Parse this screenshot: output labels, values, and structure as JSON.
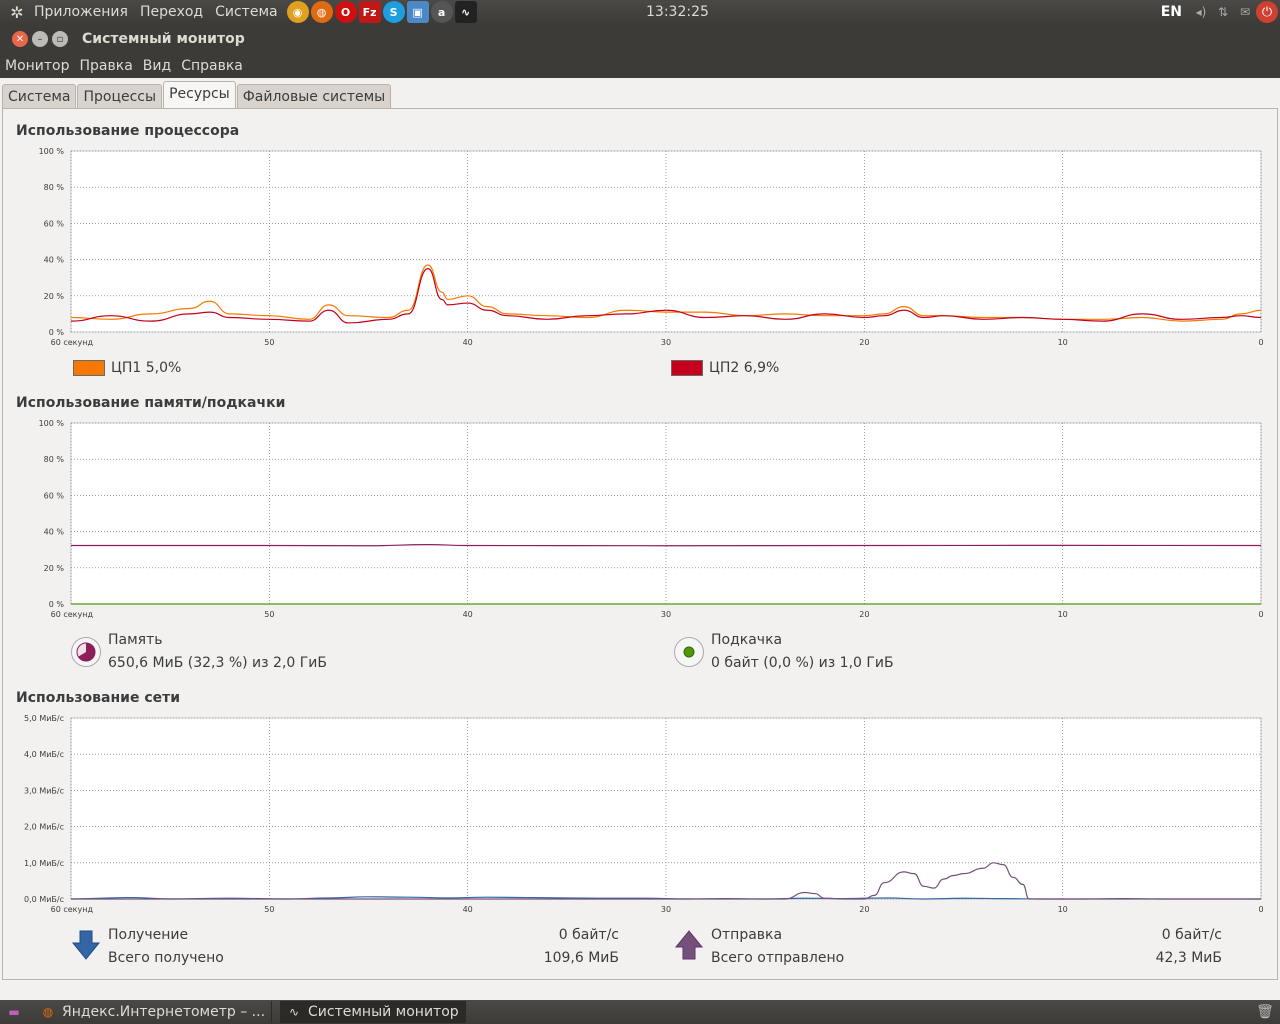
{
  "top_panel": {
    "menus": [
      "Приложения",
      "Переход",
      "Система"
    ],
    "launchers": [
      {
        "icon": "chrome-icon",
        "color": "#e0a020",
        "glyph": "◉"
      },
      {
        "icon": "firefox-icon",
        "color": "#e06a10",
        "glyph": "◍"
      },
      {
        "icon": "opera-icon",
        "color": "#d01010",
        "glyph": "O"
      },
      {
        "icon": "filezilla-icon",
        "color": "#c01818",
        "glyph": "Fz"
      },
      {
        "icon": "skype-icon",
        "color": "#1e9ee0",
        "glyph": "S"
      },
      {
        "icon": "virtualbox-icon",
        "color": "#4a88c8",
        "glyph": "▣"
      },
      {
        "icon": "at-icon",
        "color": "#555555",
        "glyph": "a"
      },
      {
        "icon": "system-monitor-icon",
        "color": "#222222",
        "glyph": "∿"
      }
    ],
    "clock": "13:32:25",
    "keyboard_layout": "EN"
  },
  "window": {
    "title": "Системный монитор",
    "menus": [
      "Монитор",
      "Правка",
      "Вид",
      "Справка"
    ],
    "tabs": [
      "Система",
      "Процессы",
      "Ресурсы",
      "Файловые системы"
    ],
    "active_tab": "Ресурсы"
  },
  "cpu": {
    "title": "Использование процессора",
    "legend": [
      {
        "label": "ЦП1 5,0%",
        "color": "#f57900"
      },
      {
        "label": "ЦП2 6,9%",
        "color": "#c4001c"
      }
    ]
  },
  "memory": {
    "title": "Использование памяти/подкачки",
    "mem_label": "Память",
    "mem_value": "650,6 МиБ (32,3 %) из 2,0 ГиБ",
    "swap_label": "Подкачка",
    "swap_value": "0 байт (0,0 %) из 1,0 ГиБ",
    "mem_color": "#8c1e5a",
    "swap_color": "#4e9a06"
  },
  "network": {
    "title": "Использование сети",
    "recv_label": "Получение",
    "recv_rate": "0 байт/с",
    "recv_total_label": "Всего получено",
    "recv_total": "109,6 МиБ",
    "send_label": "Отправка",
    "send_rate": "0 байт/с",
    "send_total_label": "Всего отправлено",
    "send_total": "42,3 МиБ",
    "recv_color": "#3465a4",
    "send_color": "#75507b"
  },
  "chart_data": [
    {
      "type": "line",
      "title": "Использование процессора",
      "x_ticks": [
        "60 секунд",
        "50",
        "40",
        "30",
        "20",
        "10",
        "0"
      ],
      "y_ticks": [
        "100 %",
        "80 %",
        "60 %",
        "40 %",
        "20 %",
        "0 %"
      ],
      "ylim": [
        0,
        100
      ],
      "xlim": [
        60,
        0
      ],
      "series": [
        {
          "name": "ЦП1 5,0%",
          "color": "#f57900",
          "x": [
            60,
            58,
            56,
            54,
            53,
            52,
            50,
            48,
            47,
            46,
            44,
            43,
            42,
            41.3,
            41,
            40,
            39,
            38,
            36,
            34,
            32,
            30,
            28,
            26,
            24,
            22,
            20,
            19,
            18,
            17,
            16,
            14,
            12,
            10,
            8,
            6,
            4,
            2,
            1,
            0
          ],
          "y": [
            8,
            7,
            10,
            13,
            17,
            10,
            9,
            7,
            15,
            9,
            8,
            12,
            37,
            22,
            18,
            20,
            14,
            10,
            9,
            8,
            12,
            11,
            11,
            9,
            10,
            9,
            9,
            10,
            14,
            9,
            9,
            8,
            8,
            7,
            7,
            8,
            6,
            7,
            10,
            12
          ]
        },
        {
          "name": "ЦП2 6,9%",
          "color": "#c4001c",
          "x": [
            60,
            58,
            56,
            54,
            53,
            52,
            50,
            48,
            47,
            46,
            44,
            43,
            42,
            41.3,
            41,
            40,
            39,
            38,
            36,
            34,
            32,
            30,
            28,
            26,
            24,
            22,
            20,
            19,
            18,
            17,
            16,
            14,
            12,
            10,
            8,
            6,
            4,
            2,
            1,
            0
          ],
          "y": [
            6,
            9,
            6,
            10,
            11,
            8,
            7,
            6,
            12,
            5,
            7,
            10,
            35,
            18,
            15,
            16,
            12,
            9,
            7,
            9,
            10,
            12,
            8,
            9,
            7,
            10,
            8,
            9,
            12,
            8,
            9,
            7,
            8,
            7,
            6,
            10,
            7,
            8,
            9,
            8
          ]
        }
      ]
    },
    {
      "type": "line",
      "title": "Использование памяти/подкачки",
      "x_ticks": [
        "60 секунд",
        "50",
        "40",
        "30",
        "20",
        "10",
        "0"
      ],
      "y_ticks": [
        "100 %",
        "80 %",
        "60 %",
        "40 %",
        "20 %",
        "0 %"
      ],
      "ylim": [
        0,
        100
      ],
      "xlim": [
        60,
        0
      ],
      "series": [
        {
          "name": "Память",
          "color": "#8c1e5a",
          "x": [
            60,
            50,
            45,
            42,
            40,
            30,
            20,
            10,
            0
          ],
          "y": [
            32.3,
            32.3,
            32.2,
            32.8,
            32.3,
            32.2,
            32.3,
            32.4,
            32.3
          ]
        },
        {
          "name": "Подкачка",
          "color": "#4e9a06",
          "x": [
            60,
            0
          ],
          "y": [
            0,
            0
          ]
        }
      ]
    },
    {
      "type": "line",
      "title": "Использование сети",
      "x_ticks": [
        "60 секунд",
        "50",
        "40",
        "30",
        "20",
        "10",
        "0"
      ],
      "y_ticks": [
        "5,0 МиБ/с",
        "4,0 МиБ/с",
        "3,0 МиБ/с",
        "2,0 МиБ/с",
        "1,0 МиБ/с",
        "0,0 МиБ/с"
      ],
      "ylim": [
        0,
        5
      ],
      "xlim": [
        60,
        0
      ],
      "series": [
        {
          "name": "Получение",
          "color": "#3465a4",
          "x": [
            60,
            57,
            55,
            52,
            49,
            47,
            45,
            43,
            41,
            39,
            37,
            35,
            33,
            31,
            29,
            27,
            25,
            23,
            21,
            19,
            17,
            15,
            13,
            11,
            9,
            7,
            5,
            3,
            0
          ],
          "y": [
            0,
            0.04,
            0,
            0.02,
            0,
            0.03,
            0.06,
            0.05,
            0.03,
            0.05,
            0.04,
            0.03,
            0.02,
            0.02,
            0,
            0.01,
            0,
            0.02,
            0.01,
            0.03,
            0,
            0.02,
            0.01,
            0,
            0,
            0.01,
            0,
            0,
            0
          ]
        },
        {
          "name": "Отправка",
          "color": "#75507b",
          "x": [
            60,
            30,
            24,
            23,
            22.5,
            22,
            21,
            20,
            19.5,
            19,
            18,
            17.5,
            17,
            16.5,
            16,
            15.5,
            15,
            14,
            13.5,
            13,
            12.5,
            12,
            11.7,
            11,
            0
          ],
          "y": [
            0,
            0,
            0,
            0.18,
            0.15,
            0.02,
            0,
            0,
            0.1,
            0.45,
            0.75,
            0.7,
            0.35,
            0.3,
            0.55,
            0.65,
            0.7,
            0.85,
            1.0,
            0.95,
            0.6,
            0.4,
            0,
            0,
            0
          ]
        }
      ]
    }
  ]
}
